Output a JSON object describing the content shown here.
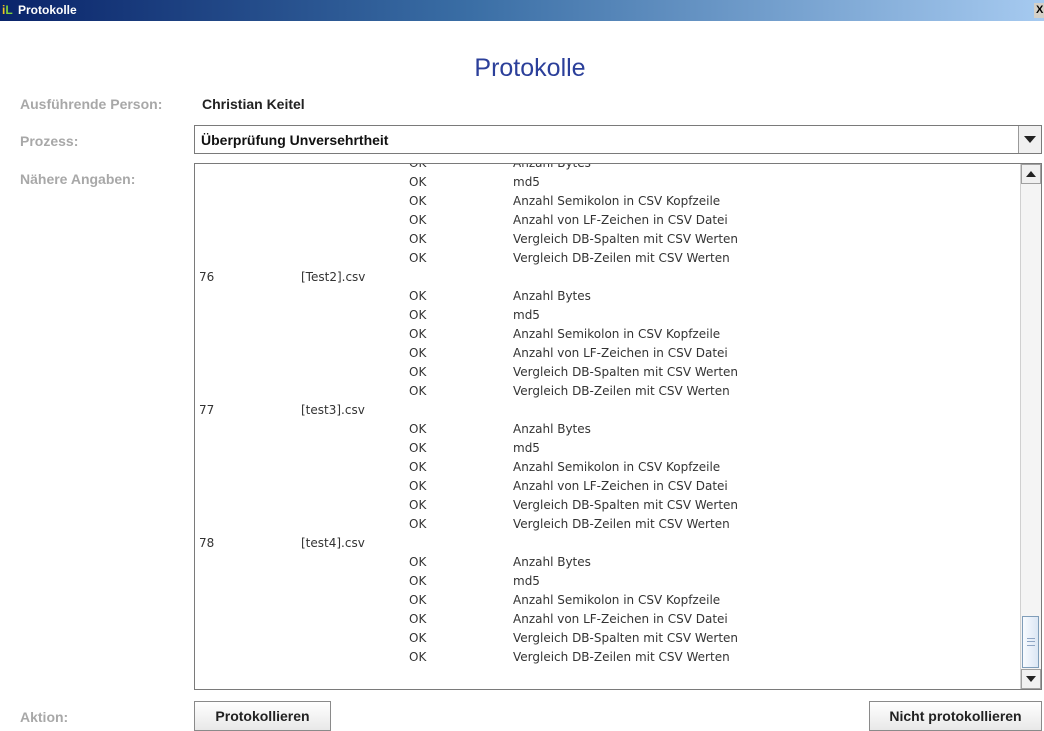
{
  "window": {
    "title": "Protokolle"
  },
  "heading": "Protokolle",
  "labels": {
    "person": "Ausführende Person:",
    "process": "Prozess:",
    "details": "Nähere Angaben:",
    "action": "Aktion:"
  },
  "person_value": "Christian Keitel",
  "process_value": "Überprüfung Unversehrtheit",
  "log_rows": [
    {
      "num": "",
      "file": "",
      "status": "OK",
      "desc": "Anzahl Bytes"
    },
    {
      "num": "",
      "file": "",
      "status": "OK",
      "desc": "md5"
    },
    {
      "num": "",
      "file": "",
      "status": "OK",
      "desc": "Anzahl Semikolon in CSV Kopfzeile"
    },
    {
      "num": "",
      "file": "",
      "status": "OK",
      "desc": "Anzahl von LF-Zeichen in CSV Datei"
    },
    {
      "num": "",
      "file": "",
      "status": "OK",
      "desc": "Vergleich DB-Spalten mit CSV Werten"
    },
    {
      "num": "",
      "file": "",
      "status": "OK",
      "desc": "Vergleich DB-Zeilen mit CSV Werten"
    },
    {
      "num": "76",
      "file": "[Test2].csv",
      "status": "",
      "desc": ""
    },
    {
      "num": "",
      "file": "",
      "status": "OK",
      "desc": "Anzahl Bytes"
    },
    {
      "num": "",
      "file": "",
      "status": "OK",
      "desc": "md5"
    },
    {
      "num": "",
      "file": "",
      "status": "OK",
      "desc": "Anzahl Semikolon in CSV Kopfzeile"
    },
    {
      "num": "",
      "file": "",
      "status": "OK",
      "desc": "Anzahl von LF-Zeichen in CSV Datei"
    },
    {
      "num": "",
      "file": "",
      "status": "OK",
      "desc": "Vergleich DB-Spalten mit CSV Werten"
    },
    {
      "num": "",
      "file": "",
      "status": "OK",
      "desc": "Vergleich DB-Zeilen mit CSV Werten"
    },
    {
      "num": "77",
      "file": "[test3].csv",
      "status": "",
      "desc": ""
    },
    {
      "num": "",
      "file": "",
      "status": "OK",
      "desc": "Anzahl Bytes"
    },
    {
      "num": "",
      "file": "",
      "status": "OK",
      "desc": "md5"
    },
    {
      "num": "",
      "file": "",
      "status": "OK",
      "desc": "Anzahl Semikolon in CSV Kopfzeile"
    },
    {
      "num": "",
      "file": "",
      "status": "OK",
      "desc": "Anzahl von LF-Zeichen in CSV Datei"
    },
    {
      "num": "",
      "file": "",
      "status": "OK",
      "desc": "Vergleich DB-Spalten mit CSV Werten"
    },
    {
      "num": "",
      "file": "",
      "status": "OK",
      "desc": "Vergleich DB-Zeilen mit CSV Werten"
    },
    {
      "num": "78",
      "file": "[test4].csv",
      "status": "",
      "desc": ""
    },
    {
      "num": "",
      "file": "",
      "status": "OK",
      "desc": "Anzahl Bytes"
    },
    {
      "num": "",
      "file": "",
      "status": "OK",
      "desc": "md5"
    },
    {
      "num": "",
      "file": "",
      "status": "OK",
      "desc": "Anzahl Semikolon in CSV Kopfzeile"
    },
    {
      "num": "",
      "file": "",
      "status": "OK",
      "desc": "Anzahl von LF-Zeichen in CSV Datei"
    },
    {
      "num": "",
      "file": "",
      "status": "OK",
      "desc": "Vergleich DB-Spalten mit CSV Werten"
    },
    {
      "num": "",
      "file": "",
      "status": "OK",
      "desc": "Vergleich DB-Zeilen mit CSV Werten"
    }
  ],
  "buttons": {
    "log": "Protokollieren",
    "no_log": "Nicht protokollieren"
  },
  "close_glyph": "X",
  "icons": {
    "app": "app-icon",
    "close": "close-icon",
    "dropdown": "chevron-down-icon",
    "scroll_up": "arrow-up-icon",
    "scroll_down": "arrow-down-icon"
  },
  "colors": {
    "title_gradient_start": "#0a246a",
    "title_gradient_end": "#a6caf0",
    "heading": "#2b3f9a",
    "label": "#a8a8a8"
  }
}
